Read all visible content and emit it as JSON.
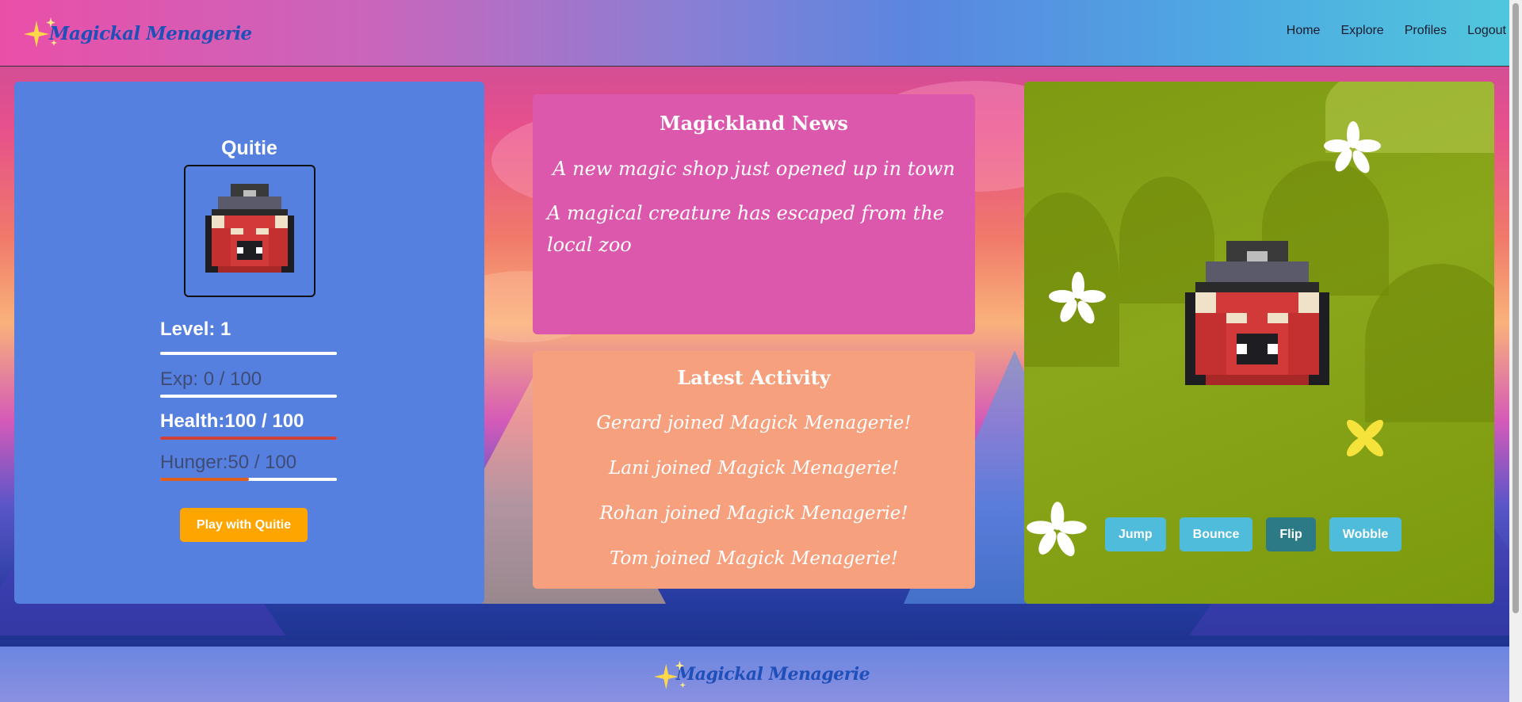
{
  "brand": {
    "name": "Magickal Menagerie"
  },
  "nav": {
    "links": [
      "Home",
      "Explore",
      "Profiles",
      "Logout"
    ]
  },
  "pet": {
    "name": "Quitie",
    "level_text": "Level: 1",
    "exp_text": "Exp: 0 / 100",
    "exp_fraction": 0.0,
    "health_text": "Health:100 / 100",
    "health_fraction": 1.0,
    "hunger_text": "Hunger:50 / 100",
    "hunger_fraction": 0.5,
    "play_button": "Play with Quitie",
    "colors": {
      "health_bar": "#d2403a",
      "hunger_bar": "#e06020",
      "play_button": "#ffa500"
    }
  },
  "news": {
    "title": "Magickland News",
    "items": [
      "A new magic shop just opened up in town",
      "A magical creature has escaped from the local zoo"
    ]
  },
  "activity": {
    "title": "Latest Activity",
    "items": [
      "Gerard joined Magick Menagerie!",
      "Lani joined Magick Menagerie!",
      "Rohan joined Magick Menagerie!",
      "Tom joined Magick Menagerie!"
    ]
  },
  "game": {
    "actions": [
      "Jump",
      "Bounce",
      "Flip",
      "Wobble"
    ],
    "active_action": "Flip"
  }
}
